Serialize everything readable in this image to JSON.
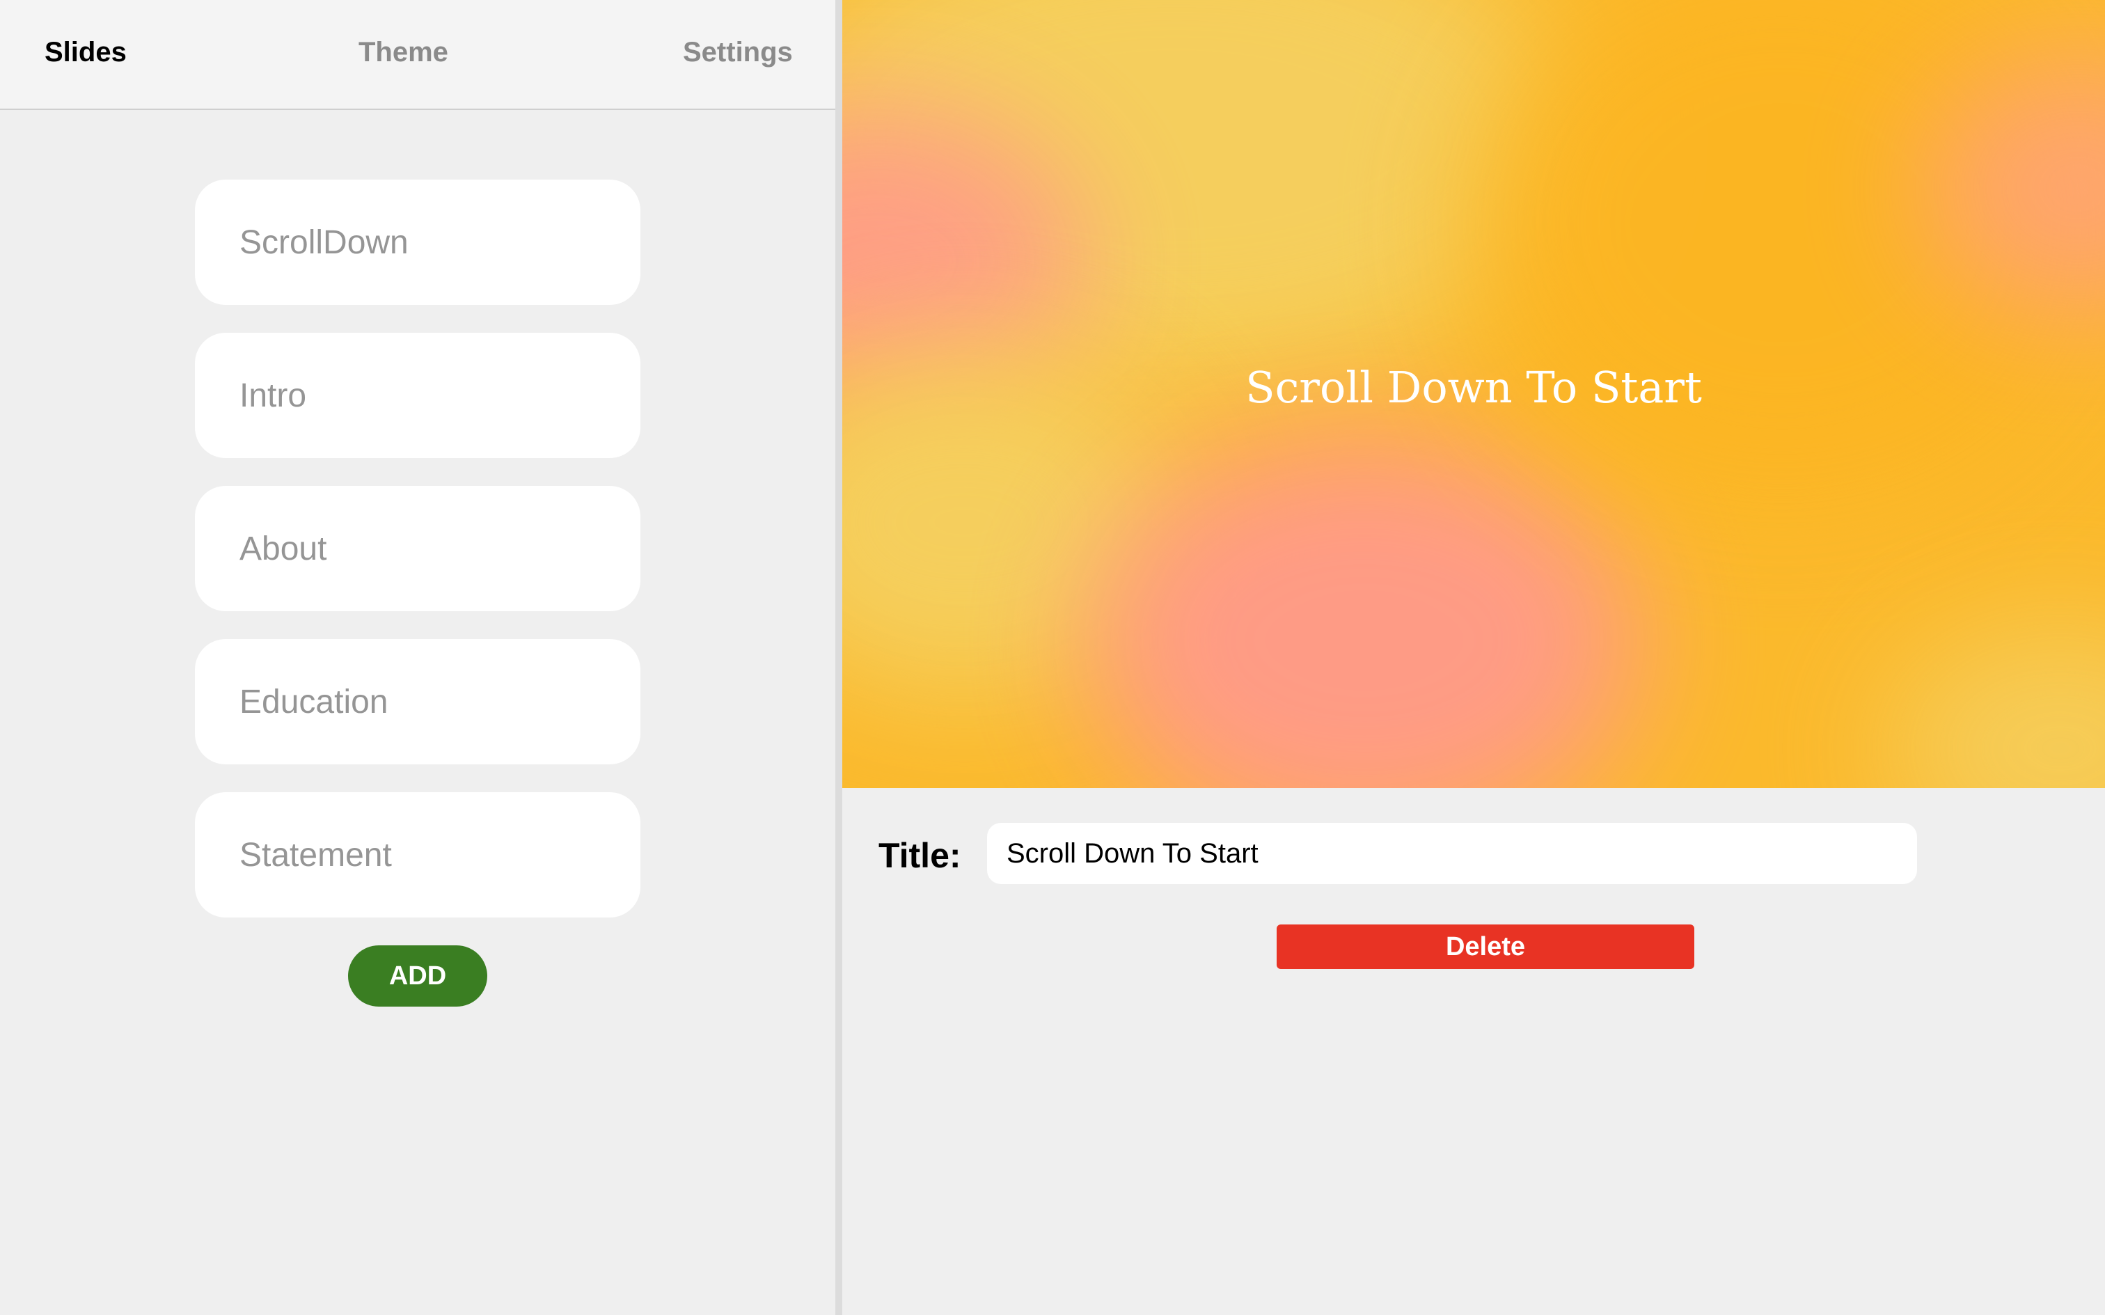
{
  "tabs": {
    "slides": "Slides",
    "theme": "Theme",
    "settings": "Settings",
    "active": "Slides"
  },
  "slides": [
    {
      "label": "ScrollDown"
    },
    {
      "label": "Intro"
    },
    {
      "label": "About"
    },
    {
      "label": "Education"
    },
    {
      "label": "Statement"
    }
  ],
  "add_button": "ADD",
  "preview": {
    "title": "Scroll Down To Start"
  },
  "editor": {
    "title_label": "Title:",
    "title_value": "Scroll Down To Start",
    "delete_label": "Delete"
  },
  "colors": {
    "add_button": "#3a7e22",
    "delete_button": "#e83324",
    "active_tab": "#000000",
    "inactive_tab": "#8a8a8a",
    "preview_base": "#fbb92c",
    "preview_pink": "#ff9a8a",
    "preview_yellow": "#f5d060"
  }
}
